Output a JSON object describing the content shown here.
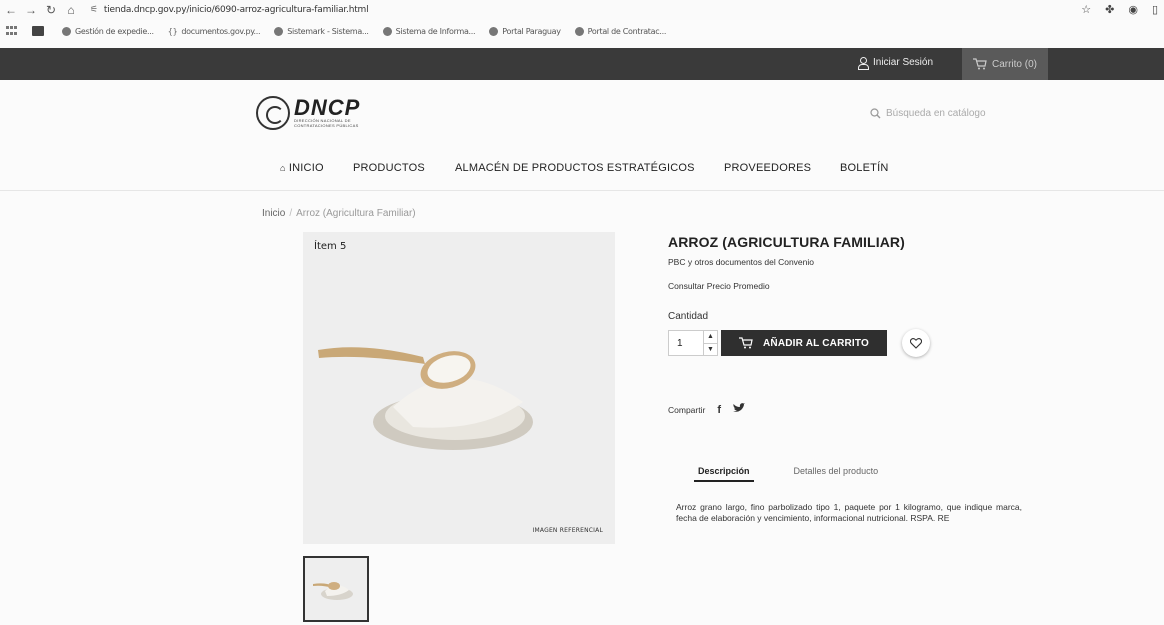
{
  "browser": {
    "url": "tienda.dncp.gov.py/inicio/6090-arroz-agricultura-familiar.html",
    "bookmarks": [
      "Gestión de expedie...",
      "documentos.gov.py...",
      "Sistemark - Sistema...",
      "Sistema de Informa...",
      "Portal Paraguay",
      "Portal de Contratac..."
    ]
  },
  "topbar": {
    "login": "Iniciar Sesión",
    "cart": "Carrito (0)"
  },
  "header": {
    "logo_main": "DNCP",
    "logo_sub_1": "DIRECCIÓN NACIONAL DE",
    "logo_sub_2": "CONTRATACIONES PÚBLICAS",
    "search_placeholder": "Búsqueda en catálogo"
  },
  "nav": {
    "items": [
      "INICIO",
      "PRODUCTOS",
      "ALMACÉN DE PRODUCTOS ESTRATÉGICOS",
      "PROVEEDORES",
      "BOLETÍN"
    ]
  },
  "breadcrumb": {
    "home": "Inicio",
    "sep": "/",
    "current": "Arroz (Agricultura Familiar)"
  },
  "product": {
    "image_label": "Ítem 5",
    "image_ref": "IMAGEN REFERENCIAL",
    "title": "ARROZ (AGRICULTURA FAMILIAR)",
    "docs_link": "PBC y otros documentos del Convenio",
    "price_link": "Consultar Precio Promedio",
    "qty_label": "Cantidad",
    "qty_value": "1",
    "add_to_cart": "AÑADIR AL CARRITO",
    "share_label": "Compartir",
    "tabs": [
      "Descripción",
      "Detalles del producto"
    ],
    "description": "Arroz grano largo, fino parbolizado tipo 1, paquete por 1 kilogramo, que indique marca, fecha de elaboración y vencimiento, informacional nutricional. RSPA. RE"
  }
}
